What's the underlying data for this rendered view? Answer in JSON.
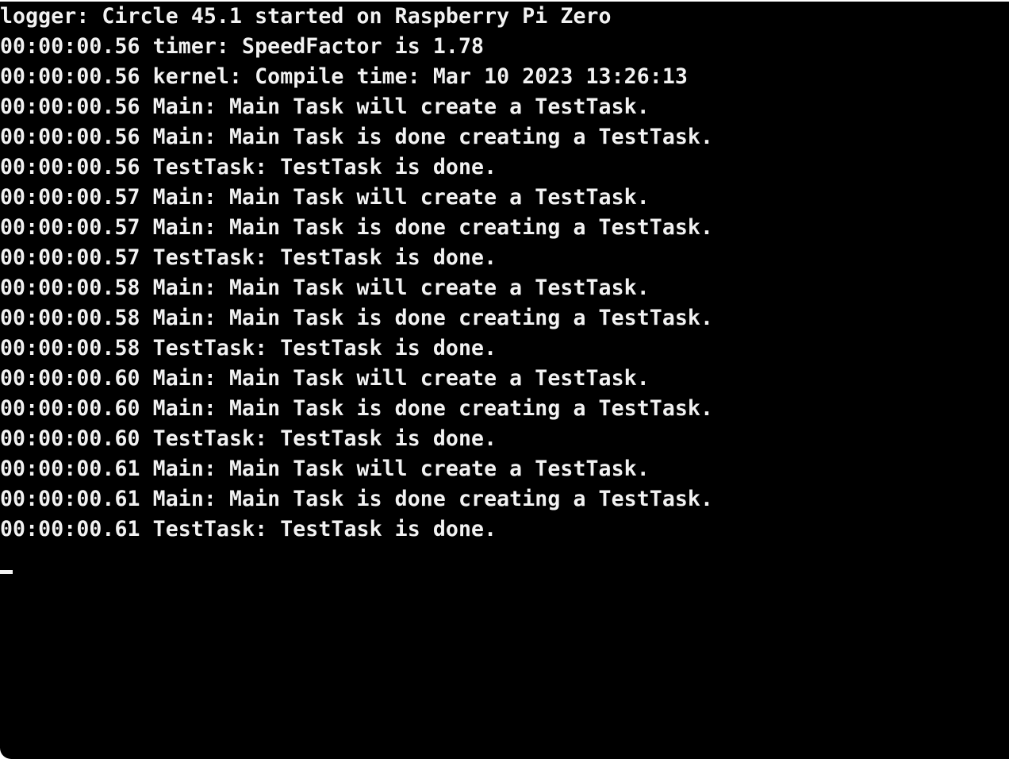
{
  "console": {
    "lines": [
      "logger: Circle 45.1 started on Raspberry Pi Zero",
      "00:00:00.56 timer: SpeedFactor is 1.78",
      "00:00:00.56 kernel: Compile time: Mar 10 2023 13:26:13",
      "00:00:00.56 Main: Main Task will create a TestTask.",
      "00:00:00.56 Main: Main Task is done creating a TestTask.",
      "00:00:00.56 TestTask: TestTask is done.",
      "00:00:00.57 Main: Main Task will create a TestTask.",
      "00:00:00.57 Main: Main Task is done creating a TestTask.",
      "00:00:00.57 TestTask: TestTask is done.",
      "00:00:00.58 Main: Main Task will create a TestTask.",
      "00:00:00.58 Main: Main Task is done creating a TestTask.",
      "00:00:00.58 TestTask: TestTask is done.",
      "00:00:00.60 Main: Main Task will create a TestTask.",
      "00:00:00.60 Main: Main Task is done creating a TestTask.",
      "00:00:00.60 TestTask: TestTask is done.",
      "00:00:00.61 Main: Main Task will create a TestTask.",
      "00:00:00.61 Main: Main Task is done creating a TestTask.",
      "00:00:00.61 TestTask: TestTask is done."
    ]
  },
  "colors": {
    "background": "#000000",
    "text": "#f2f2f2"
  }
}
